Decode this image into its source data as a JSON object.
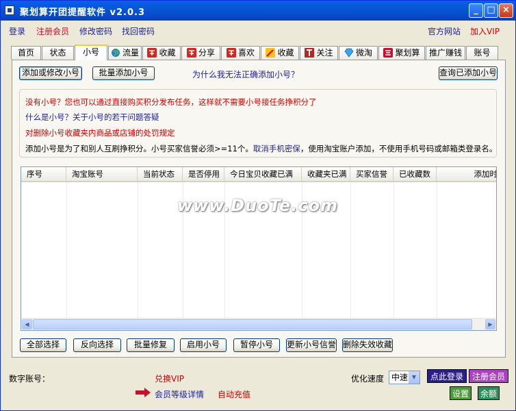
{
  "window": {
    "title": "聚划算开团提醒软件  v2.0.3",
    "min_symbol": "_",
    "max_symbol": "□",
    "close_symbol": "×"
  },
  "menubar": {
    "login": "登录",
    "register": "注册会员",
    "change_password": "修改密码",
    "recover_password": "找回密码",
    "official_site": "官方网站",
    "join_vip": "加入VIP"
  },
  "tabs": [
    {
      "label": "首页",
      "icon": ""
    },
    {
      "label": "状态",
      "icon": ""
    },
    {
      "label": "小号",
      "icon": ""
    },
    {
      "label": "流量",
      "icon": "globe-icon"
    },
    {
      "label": "收藏",
      "icon": "taobao-icon"
    },
    {
      "label": "分享",
      "icon": "taobao-icon"
    },
    {
      "label": "喜欢",
      "icon": "taobao-icon"
    },
    {
      "label": "收藏",
      "icon": "pen-icon"
    },
    {
      "label": "关注",
      "icon": "t-icon"
    },
    {
      "label": "微淘",
      "icon": "diamond-icon"
    },
    {
      "label": "聚划算",
      "icon": "ju-icon"
    },
    {
      "label": "推广赚钱",
      "icon": ""
    },
    {
      "label": "账号",
      "icon": ""
    }
  ],
  "active_tab": "小号",
  "top_actions": {
    "add_or_edit": "添加或修改小号",
    "batch_add": "批量添加小号",
    "why_link": "为什么我无法正确添加小号？",
    "query_added": "查询已添加小号"
  },
  "info": {
    "line1": "没有小号？您也可以通过直接购买积分发布任务，这样就不需要小号接任务挣积分了",
    "line2": "什么是小号？关于小号的若干问题答疑",
    "line3": "对删除小号收藏夹内商品或店铺的处罚规定",
    "line4_pre": "添加小号是为了和别人互刷挣积分。小号买家信誉必须>=11个。",
    "line4_link": "取消手机密保",
    "line4_post": "，使用淘宝账户添加，不使用手机号码或邮箱类登录名。"
  },
  "table": {
    "columns": [
      "序号",
      "淘宝账号",
      "当前状态",
      "是否停用",
      "今日宝贝收藏已满",
      "收藏夹已满",
      "买家信誉",
      "已收藏数",
      "添加时"
    ],
    "rows": []
  },
  "bottom_actions": [
    "全部选择",
    "反向选择",
    "批量修复",
    "启用小号",
    "暂停小号",
    "更新小号信誉",
    "删除失效收藏"
  ],
  "footer": {
    "digital_account_label": "数字账号：",
    "exchange_vip": "兑换VIP",
    "member_level": "会员等级详情",
    "auto_recharge": "自动充值",
    "speed_label": "优化速度",
    "speed_value": "中速",
    "login_here": "点此登录",
    "register_member": "注册会员",
    "settings": "设置",
    "wallet": "余额"
  },
  "watermark": "www.DuoTe.com",
  "colors": {
    "link_blue": "#1B1F9C",
    "link_red": "#D20000",
    "brand_red": "#C8102E",
    "vip_red": "#E00000"
  }
}
